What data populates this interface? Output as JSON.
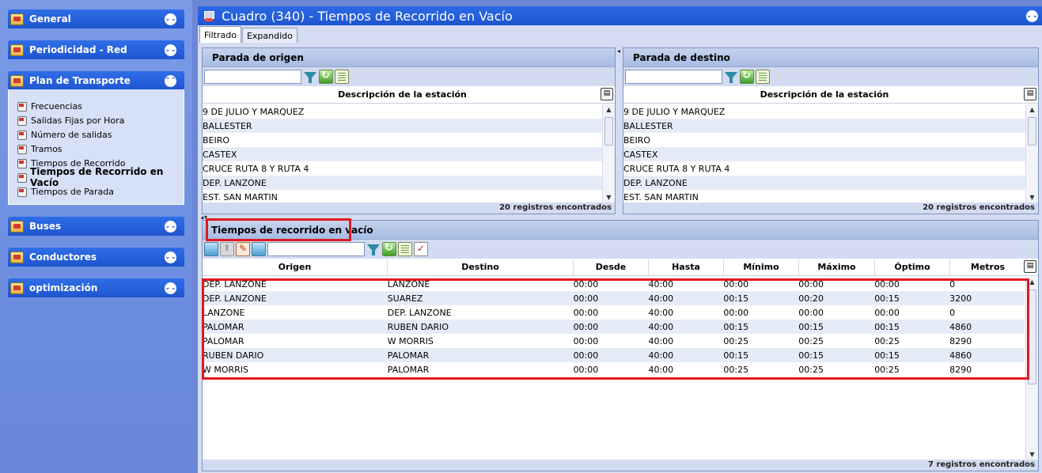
{
  "sidebar": {
    "sections": [
      {
        "label": "General",
        "icon": "general-icon"
      },
      {
        "label": "Periodicidad - Red",
        "icon": "periodicidad-icon"
      },
      {
        "label": "Plan de Transporte",
        "icon": "plan-transporte-icon"
      },
      {
        "label": "Buses",
        "icon": "buses-icon"
      },
      {
        "label": "Conductores",
        "icon": "conductores-icon"
      },
      {
        "label": "optimización",
        "icon": "optimizacion-icon"
      }
    ],
    "plan_items": [
      "Frecuencias",
      "Salidas Fijas por Hora",
      "Número de salidas",
      "Tramos",
      "Tiempos de Recorrido",
      "Tiempos de Recorrido en Vacío",
      "Tiempos de Parada"
    ],
    "active_item": "Tiempos de Recorrido en Vacío"
  },
  "main": {
    "title": "Cuadro (340) - Tiempos de Recorrido en Vacío",
    "tabs": [
      {
        "label": "Filtrado",
        "active": true
      },
      {
        "label": "Expandido",
        "active": false
      }
    ]
  },
  "origen": {
    "title": "Parada de origen",
    "search_value": "",
    "column": "Descripción de la estación",
    "rows": [
      "9 DE JULIO Y MARQUEZ",
      "BALLESTER",
      "BEIRO",
      "CASTEX",
      "CRUCE RUTA 8 Y RUTA 4",
      "DEP. LANZONE",
      "EST. SAN MARTIN"
    ],
    "footer": "20 registros encontrados"
  },
  "destino": {
    "title": "Parada de destino",
    "search_value": "",
    "column": "Descripción de la estación",
    "rows": [
      "9 DE JULIO Y MARQUEZ",
      "BALLESTER",
      "BEIRO",
      "CASTEX",
      "CRUCE RUTA 8 Y RUTA 4",
      "DEP. LANZONE",
      "EST. SAN MARTIN"
    ],
    "footer": "20 registros encontrados"
  },
  "tiempos": {
    "title": "Tiempos de recorrido en vacío",
    "search_value": "",
    "columns": [
      "Origen",
      "Destino",
      "Desde",
      "Hasta",
      "Mínimo",
      "Máximo",
      "Óptimo",
      "Metros"
    ],
    "rows": [
      [
        "DEP. LANZONE",
        "LANZONE",
        "00:00",
        "40:00",
        "00:00",
        "00:00",
        "00:00",
        "0"
      ],
      [
        "DEP. LANZONE",
        "SUAREZ",
        "00:00",
        "40:00",
        "00:15",
        "00:20",
        "00:15",
        "3200"
      ],
      [
        "LANZONE",
        "DEP. LANZONE",
        "00:00",
        "40:00",
        "00:00",
        "00:00",
        "00:00",
        "0"
      ],
      [
        "PALOMAR",
        "RUBEN DARIO",
        "00:00",
        "40:00",
        "00:15",
        "00:15",
        "00:15",
        "4860"
      ],
      [
        "PALOMAR",
        "W MORRIS",
        "00:00",
        "40:00",
        "00:25",
        "00:25",
        "00:25",
        "8290"
      ],
      [
        "RUBEN DARIO",
        "PALOMAR",
        "00:00",
        "40:00",
        "00:15",
        "00:15",
        "00:15",
        "4860"
      ],
      [
        "W MORRIS",
        "PALOMAR",
        "00:00",
        "40:00",
        "00:25",
        "00:25",
        "00:25",
        "8290"
      ]
    ],
    "footer": "7 registros encontrados"
  },
  "colors": {
    "header_blue": "#1f56cf",
    "sidebar_bg": "#6d8ee0",
    "highlight_red": "#e0191e"
  }
}
